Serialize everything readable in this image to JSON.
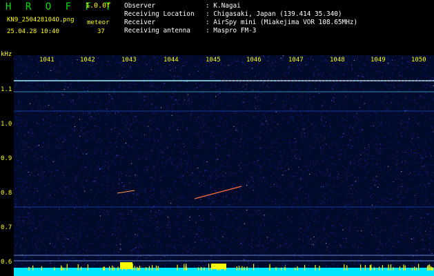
{
  "header": {
    "title": "H R O F F T",
    "version": "1.0.0f",
    "filename": "KN9_250428104O.png",
    "meteor_label": "meteor",
    "datetime": "25.04.28 10:40",
    "meteor_count": "37"
  },
  "metadata": {
    "rows": [
      {
        "label": "Observer",
        "value": ": K.Nagai"
      },
      {
        "label": "Receiving Location",
        "value": ": Chigasaki, Japan (139.414 35.340)"
      },
      {
        "label": "Receiver",
        "value": ": AirSpy mini (Miakejima VOR 108.65MHz)"
      },
      {
        "label": "Receiving antenna",
        "value": ": Maspro FM-3"
      }
    ]
  },
  "axes": {
    "y_unit": "kHz",
    "x_ticks": [
      "1041",
      "1042",
      "1043",
      "1044",
      "1045",
      "1046",
      "1047",
      "1048",
      "1049",
      "1050"
    ],
    "y_ticks": [
      "1.1",
      "1.0",
      "0.9",
      "0.8",
      "0.7",
      "0.6"
    ]
  },
  "colors": {
    "label": "#ffff00",
    "title": "#00e000",
    "background": "#000a2a",
    "noise": "#1a3cff",
    "bottom_band": "#00e5ff"
  }
}
